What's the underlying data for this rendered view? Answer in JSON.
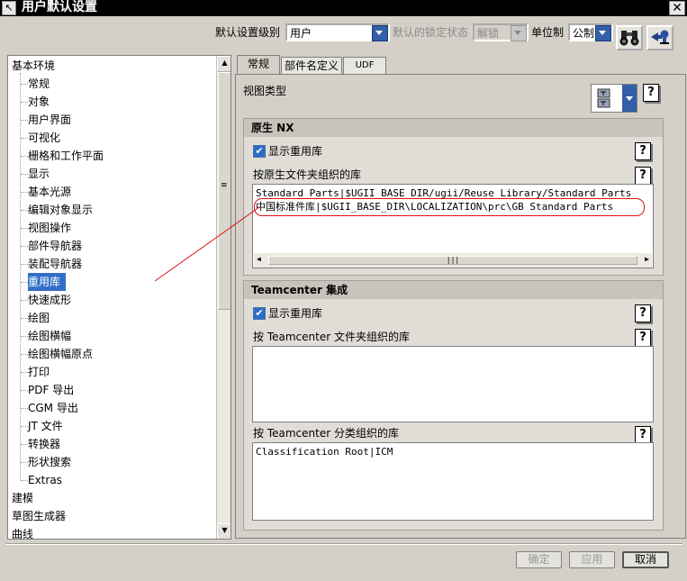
{
  "window": {
    "title": "用户默认设置",
    "close_glyph": "✕",
    "sys_icon_glyph": "↖"
  },
  "toolbar": {
    "level_label": "默认设置级别",
    "level_value": "用户",
    "lock_label": "默认的锁定状态",
    "lock_value": "解锁",
    "unit_label": "单位制",
    "unit_value": "公制"
  },
  "tree": {
    "items": [
      {
        "label": "基本环境",
        "level": 0
      },
      {
        "label": "常规",
        "level": 1
      },
      {
        "label": "对象",
        "level": 1
      },
      {
        "label": "用户界面",
        "level": 1
      },
      {
        "label": "可视化",
        "level": 1
      },
      {
        "label": "栅格和工作平面",
        "level": 1
      },
      {
        "label": "显示",
        "level": 1
      },
      {
        "label": "基本光源",
        "level": 1
      },
      {
        "label": "编辑对象显示",
        "level": 1
      },
      {
        "label": "视图操作",
        "level": 1
      },
      {
        "label": "部件导航器",
        "level": 1
      },
      {
        "label": "装配导航器",
        "level": 1
      },
      {
        "label": "重用库",
        "level": 1,
        "selected": true
      },
      {
        "label": "快速成形",
        "level": 1
      },
      {
        "label": "绘图",
        "level": 1
      },
      {
        "label": "绘图横幅",
        "level": 1
      },
      {
        "label": "绘图横幅原点",
        "level": 1
      },
      {
        "label": "打印",
        "level": 1
      },
      {
        "label": "PDF 导出",
        "level": 1
      },
      {
        "label": "CGM 导出",
        "level": 1
      },
      {
        "label": "JT 文件",
        "level": 1
      },
      {
        "label": "转换器",
        "level": 1
      },
      {
        "label": "形状搜索",
        "level": 1
      },
      {
        "label": "Extras",
        "level": 1
      },
      {
        "label": "建模",
        "level": 0
      },
      {
        "label": "草图生成器",
        "level": 0
      },
      {
        "label": "曲线",
        "level": 0
      }
    ]
  },
  "tabs": [
    {
      "label": "常规",
      "active": true
    },
    {
      "label": "部件名定义",
      "active": false
    },
    {
      "label": "UDF",
      "active": false
    }
  ],
  "view_type": {
    "label": "视图类型"
  },
  "native_nx": {
    "title": "原生 NX",
    "show_reuse_label": "显示重用库",
    "show_reuse_checked": true,
    "folder_lib_label": "按原生文件夹组织的库",
    "folder_lib_lines": [
      "Standard Parts|$UGII_BASE_DIR/ugii/Reuse Library/Standard Parts",
      "中国标准件库|$UGII_BASE_DIR\\LOCALIZATION\\prc\\GB Standard Parts"
    ]
  },
  "teamcenter": {
    "title": "Teamcenter 集成",
    "show_reuse_label": "显示重用库",
    "show_reuse_checked": true,
    "folder_lib_label": "按 Teamcenter 文件夹组织的库",
    "folder_lib_lines": [],
    "class_lib_label": "按 Teamcenter 分类组织的库",
    "class_lib_lines": [
      "Classification Root|ICM"
    ]
  },
  "help_glyph": "?",
  "buttons": {
    "ok": "确定",
    "apply": "应用",
    "cancel": "取消"
  },
  "colors": {
    "selection": "#336fc8",
    "annotation": "#dd1111",
    "combo_arrow": "#335fa8"
  }
}
